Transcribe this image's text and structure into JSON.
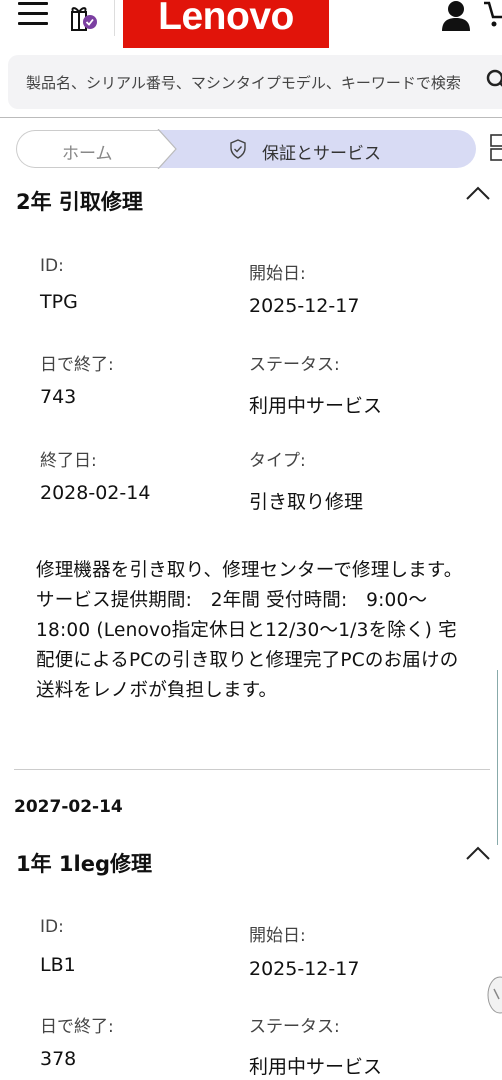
{
  "header": {
    "logo_text": "Lenovo",
    "logo_color": "#e1140a"
  },
  "search": {
    "placeholder": "製品名、シリアル番号、マシンタイプモデル、キーワードで検索"
  },
  "breadcrumb": {
    "home": "ホーム",
    "current": "保証とサービス",
    "current_bg": "#d8dbf4"
  },
  "warranties": [
    {
      "title": "2年 引取修理",
      "id_label": "ID:",
      "id": "TPG",
      "start_label": "開始日:",
      "start": "2025-12-17",
      "days_label": "日で終了:",
      "days": "743",
      "status_label": "ステータス:",
      "status": "利用中サービス",
      "end_label": "終了日:",
      "end": "2028-02-14",
      "type_label": "タイプ:",
      "type": "引き取り修理",
      "description": "修理機器を引き取り、修理センターで修理します。 サービス提供期間:　2年間 受付時間:　9:00〜18:00 (Lenovo指定休日と12/30〜1/3を除く) 宅配便によるPCの引き取りと修理完了PCのお届けの送料をレノボが負担します。"
    },
    {
      "date_header": "2027-02-14",
      "title": "1年 1leg修理",
      "id_label": "ID:",
      "id": "LB1",
      "start_label": "開始日:",
      "start": "2025-12-17",
      "days_label": "日で終了:",
      "days": "378",
      "status_label": "ステータス:",
      "status": "利用中サービス"
    }
  ]
}
